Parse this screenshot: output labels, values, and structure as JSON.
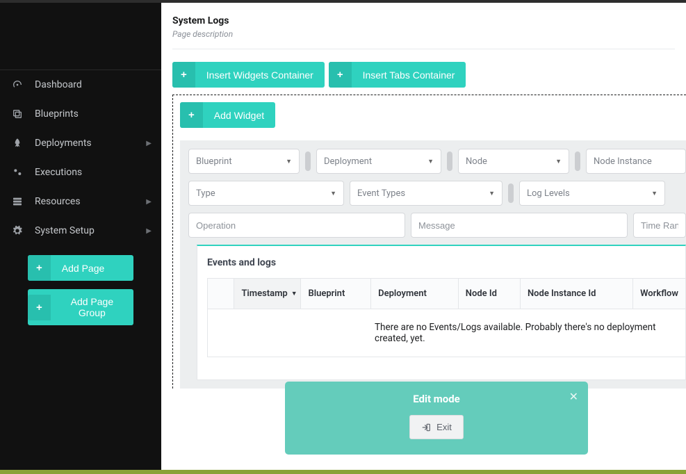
{
  "sidebar": {
    "items": [
      {
        "label": "Dashboard",
        "icon": "gauge-icon",
        "expandable": false
      },
      {
        "label": "Blueprints",
        "icon": "copy-icon",
        "expandable": false
      },
      {
        "label": "Deployments",
        "icon": "rocket-icon",
        "expandable": true
      },
      {
        "label": "Executions",
        "icon": "cogs-icon",
        "expandable": false
      },
      {
        "label": "Resources",
        "icon": "server-icon",
        "expandable": true
      },
      {
        "label": "System Setup",
        "icon": "gear-icon",
        "expandable": true
      }
    ],
    "add_page_label": "Add Page",
    "add_page_group_label": "Add Page Group"
  },
  "header": {
    "title": "System Logs",
    "description": "Page description"
  },
  "actions": {
    "insert_widgets_container": "Insert Widgets Container",
    "insert_tabs_container": "Insert Tabs Container",
    "add_widget": "Add Widget"
  },
  "filters": {
    "row1": [
      {
        "label": "Blueprint"
      },
      {
        "label": "Deployment"
      },
      {
        "label": "Node"
      },
      {
        "label": "Node Instance"
      }
    ],
    "row2": [
      {
        "label": "Type"
      },
      {
        "label": "Event Types"
      },
      {
        "label": "Log Levels"
      }
    ],
    "row3": [
      {
        "placeholder": "Operation"
      },
      {
        "placeholder": "Message"
      },
      {
        "placeholder": "Time Rang"
      }
    ]
  },
  "events": {
    "title": "Events and logs",
    "columns": [
      "Timestamp",
      "Blueprint",
      "Deployment",
      "Node Id",
      "Node Instance Id",
      "Workflow"
    ],
    "empty_message": "There are no Events/Logs available. Probably there's no deployment created, yet."
  },
  "edit_mode": {
    "title": "Edit mode",
    "exit_label": "Exit"
  }
}
